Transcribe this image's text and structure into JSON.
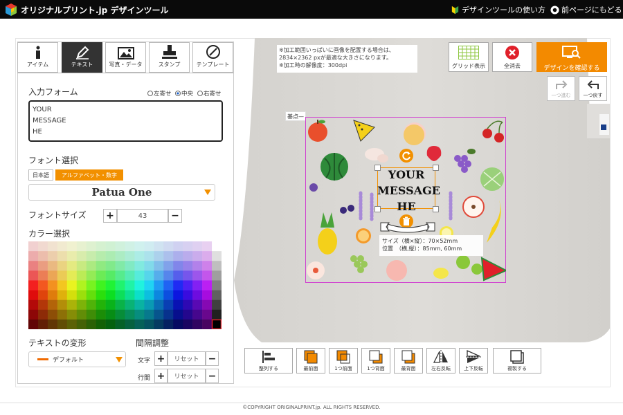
{
  "header": {
    "logo_text": "オリジナルプリント.jp デザインツール",
    "howto_label": "デザインツールの使い方",
    "back_label": "前ページにもどる"
  },
  "tabs": [
    {
      "label": "アイテム",
      "icon": "info-icon"
    },
    {
      "label": "テキスト",
      "icon": "pen-icon",
      "active": true
    },
    {
      "label": "写真・データ",
      "icon": "image-icon"
    },
    {
      "label": "スタンプ",
      "icon": "stamp-icon"
    },
    {
      "label": "テンプレート",
      "icon": "compass-icon"
    }
  ],
  "text_panel": {
    "input_label": "入力フォーム",
    "align_options": [
      "左寄せ",
      "中央",
      "右寄せ"
    ],
    "align_selected": "中央",
    "input_value": "YOUR\nMESSAGE\nHE",
    "font_label": "フォント選択",
    "font_tabs": [
      "日本語",
      "アルファベット・数字"
    ],
    "font_tab_active": "アルファベット・数字",
    "font_name": "Patua One",
    "size_label": "フォントサイズ",
    "size_value": "43",
    "color_label": "カラー選択",
    "transform_label": "テキストの変形",
    "transform_value": "デフォルト",
    "spacing_label": "間隔調整",
    "char_label": "文字",
    "line_label": "行間",
    "reset_label": "リセット"
  },
  "notice": {
    "lines": "※加工範囲いっぱいに画像を配置する場合は、\n2834×2362 pxが最適な大きさになります。\n※加工時の解像度：300dpi"
  },
  "toolbar": {
    "grid_label": "グリッド表示",
    "clear_label": "全消去",
    "confirm_label": "デザインを確認する",
    "redo_label": "一つ進む",
    "undo_label": "一つ戻す"
  },
  "canvas": {
    "kijun_label": "基点",
    "message": "YOUR\nMESSAGE\nHE",
    "info": "サイズ（横×縦）：70×52mm\n位置　（横,縦）：85mm, 60mm"
  },
  "bottom_toolbar": [
    {
      "label": "整列する",
      "icon": "align-icon"
    },
    {
      "label": "最前面",
      "icon": "bring-front-icon"
    },
    {
      "label": "1つ前面",
      "icon": "bring-forward-icon"
    },
    {
      "label": "1つ背面",
      "icon": "send-backward-icon"
    },
    {
      "label": "最背面",
      "icon": "send-back-icon"
    },
    {
      "label": "左右反転",
      "icon": "flip-h-icon"
    },
    {
      "label": "上下反転",
      "icon": "flip-v-icon"
    },
    {
      "label": "複製する",
      "icon": "duplicate-icon"
    }
  ],
  "footer": {
    "copyright": "©COPYRIGHT ORIGINALPRINT.jp. ALL RIGHTS RESERVED."
  },
  "colors": {
    "accent": "#f38a00",
    "header": "#0a0a0a",
    "active_tab": "#333333",
    "area_border": "#d040d0"
  }
}
